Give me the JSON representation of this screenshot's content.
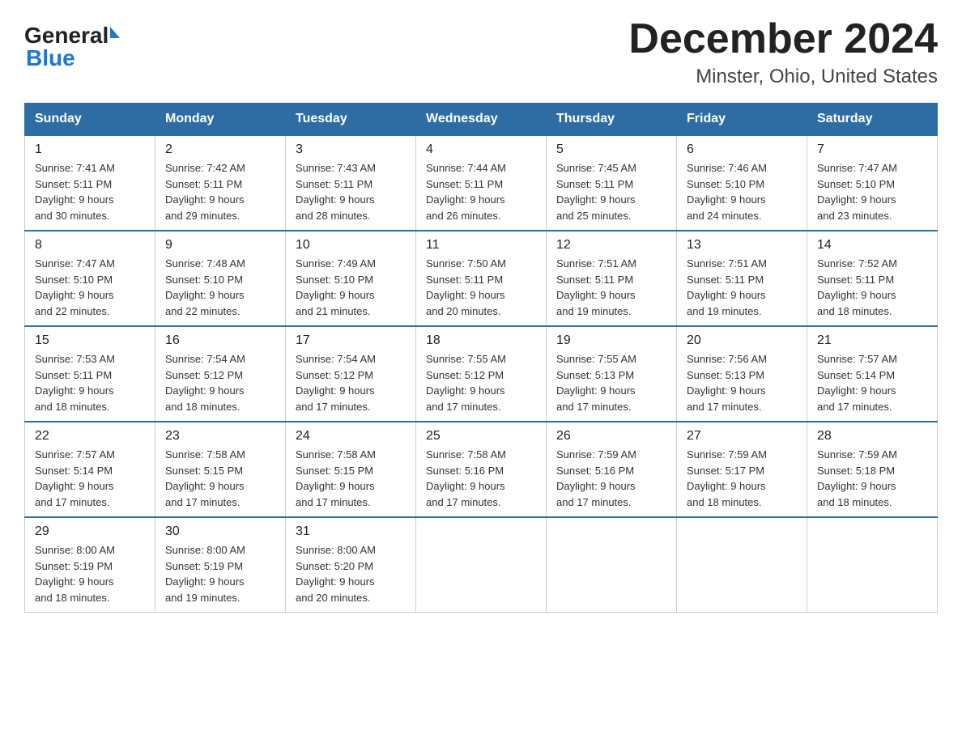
{
  "logo": {
    "general": "General",
    "blue": "Blue"
  },
  "title": "December 2024",
  "location": "Minster, Ohio, United States",
  "days_of_week": [
    "Sunday",
    "Monday",
    "Tuesday",
    "Wednesday",
    "Thursday",
    "Friday",
    "Saturday"
  ],
  "weeks": [
    [
      {
        "day": "1",
        "sunrise": "7:41 AM",
        "sunset": "5:11 PM",
        "daylight": "9 hours and 30 minutes."
      },
      {
        "day": "2",
        "sunrise": "7:42 AM",
        "sunset": "5:11 PM",
        "daylight": "9 hours and 29 minutes."
      },
      {
        "day": "3",
        "sunrise": "7:43 AM",
        "sunset": "5:11 PM",
        "daylight": "9 hours and 28 minutes."
      },
      {
        "day": "4",
        "sunrise": "7:44 AM",
        "sunset": "5:11 PM",
        "daylight": "9 hours and 26 minutes."
      },
      {
        "day": "5",
        "sunrise": "7:45 AM",
        "sunset": "5:11 PM",
        "daylight": "9 hours and 25 minutes."
      },
      {
        "day": "6",
        "sunrise": "7:46 AM",
        "sunset": "5:10 PM",
        "daylight": "9 hours and 24 minutes."
      },
      {
        "day": "7",
        "sunrise": "7:47 AM",
        "sunset": "5:10 PM",
        "daylight": "9 hours and 23 minutes."
      }
    ],
    [
      {
        "day": "8",
        "sunrise": "7:47 AM",
        "sunset": "5:10 PM",
        "daylight": "9 hours and 22 minutes."
      },
      {
        "day": "9",
        "sunrise": "7:48 AM",
        "sunset": "5:10 PM",
        "daylight": "9 hours and 22 minutes."
      },
      {
        "day": "10",
        "sunrise": "7:49 AM",
        "sunset": "5:10 PM",
        "daylight": "9 hours and 21 minutes."
      },
      {
        "day": "11",
        "sunrise": "7:50 AM",
        "sunset": "5:11 PM",
        "daylight": "9 hours and 20 minutes."
      },
      {
        "day": "12",
        "sunrise": "7:51 AM",
        "sunset": "5:11 PM",
        "daylight": "9 hours and 19 minutes."
      },
      {
        "day": "13",
        "sunrise": "7:51 AM",
        "sunset": "5:11 PM",
        "daylight": "9 hours and 19 minutes."
      },
      {
        "day": "14",
        "sunrise": "7:52 AM",
        "sunset": "5:11 PM",
        "daylight": "9 hours and 18 minutes."
      }
    ],
    [
      {
        "day": "15",
        "sunrise": "7:53 AM",
        "sunset": "5:11 PM",
        "daylight": "9 hours and 18 minutes."
      },
      {
        "day": "16",
        "sunrise": "7:54 AM",
        "sunset": "5:12 PM",
        "daylight": "9 hours and 18 minutes."
      },
      {
        "day": "17",
        "sunrise": "7:54 AM",
        "sunset": "5:12 PM",
        "daylight": "9 hours and 17 minutes."
      },
      {
        "day": "18",
        "sunrise": "7:55 AM",
        "sunset": "5:12 PM",
        "daylight": "9 hours and 17 minutes."
      },
      {
        "day": "19",
        "sunrise": "7:55 AM",
        "sunset": "5:13 PM",
        "daylight": "9 hours and 17 minutes."
      },
      {
        "day": "20",
        "sunrise": "7:56 AM",
        "sunset": "5:13 PM",
        "daylight": "9 hours and 17 minutes."
      },
      {
        "day": "21",
        "sunrise": "7:57 AM",
        "sunset": "5:14 PM",
        "daylight": "9 hours and 17 minutes."
      }
    ],
    [
      {
        "day": "22",
        "sunrise": "7:57 AM",
        "sunset": "5:14 PM",
        "daylight": "9 hours and 17 minutes."
      },
      {
        "day": "23",
        "sunrise": "7:58 AM",
        "sunset": "5:15 PM",
        "daylight": "9 hours and 17 minutes."
      },
      {
        "day": "24",
        "sunrise": "7:58 AM",
        "sunset": "5:15 PM",
        "daylight": "9 hours and 17 minutes."
      },
      {
        "day": "25",
        "sunrise": "7:58 AM",
        "sunset": "5:16 PM",
        "daylight": "9 hours and 17 minutes."
      },
      {
        "day": "26",
        "sunrise": "7:59 AM",
        "sunset": "5:16 PM",
        "daylight": "9 hours and 17 minutes."
      },
      {
        "day": "27",
        "sunrise": "7:59 AM",
        "sunset": "5:17 PM",
        "daylight": "9 hours and 18 minutes."
      },
      {
        "day": "28",
        "sunrise": "7:59 AM",
        "sunset": "5:18 PM",
        "daylight": "9 hours and 18 minutes."
      }
    ],
    [
      {
        "day": "29",
        "sunrise": "8:00 AM",
        "sunset": "5:19 PM",
        "daylight": "9 hours and 18 minutes."
      },
      {
        "day": "30",
        "sunrise": "8:00 AM",
        "sunset": "5:19 PM",
        "daylight": "9 hours and 19 minutes."
      },
      {
        "day": "31",
        "sunrise": "8:00 AM",
        "sunset": "5:20 PM",
        "daylight": "9 hours and 20 minutes."
      },
      null,
      null,
      null,
      null
    ]
  ],
  "labels": {
    "sunrise": "Sunrise:",
    "sunset": "Sunset:",
    "daylight": "Daylight:"
  },
  "colors": {
    "header_bg": "#2e6da4",
    "header_text": "#ffffff",
    "border_top": "#2e6da4"
  }
}
